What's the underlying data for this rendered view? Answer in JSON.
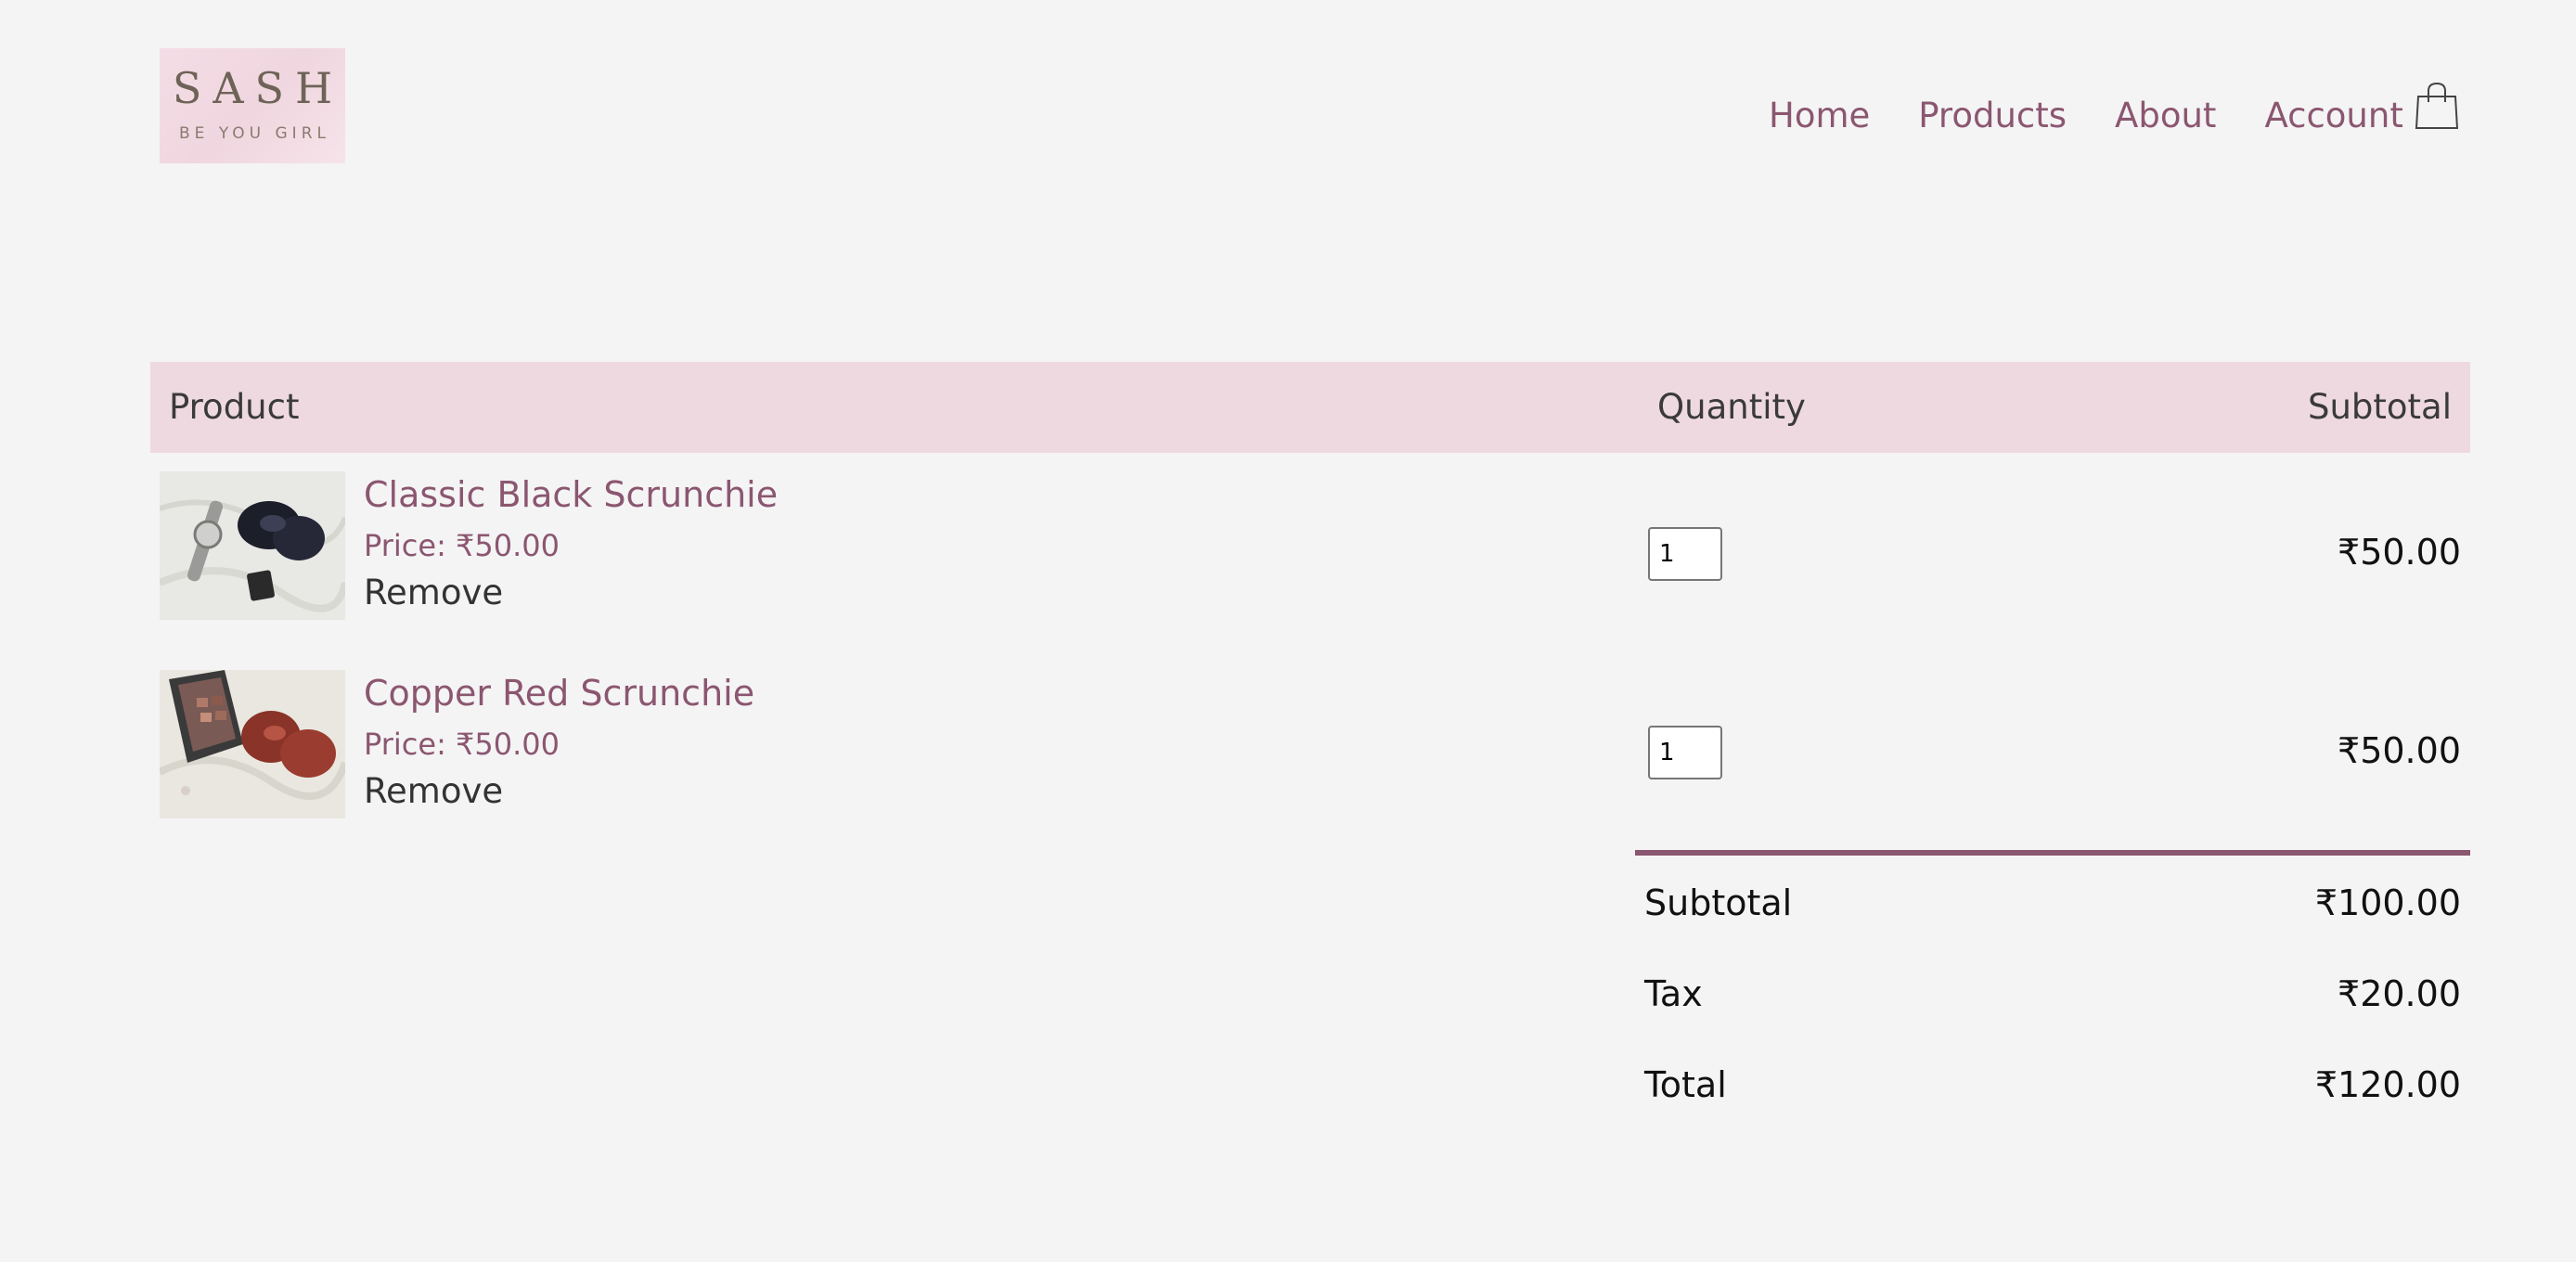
{
  "brand": {
    "logo_main": "SASH",
    "logo_tagline": "BE YOU GIRL"
  },
  "nav": {
    "items": [
      {
        "label": "Home"
      },
      {
        "label": "Products"
      },
      {
        "label": "About"
      },
      {
        "label": "Account"
      }
    ],
    "cart_icon": "shopping-bag-icon"
  },
  "cart": {
    "headers": {
      "product": "Product",
      "quantity": "Quantity",
      "subtotal": "Subtotal"
    },
    "items": [
      {
        "name": "Classic Black Scrunchie",
        "price": "Price: ₹50.00",
        "remove": "Remove",
        "quantity": "1",
        "subtotal": "₹50.00",
        "image": "black-scrunchie-photo"
      },
      {
        "name": "Copper Red Scrunchie",
        "price": "Price: ₹50.00",
        "remove": "Remove",
        "quantity": "1",
        "subtotal": "₹50.00",
        "image": "copper-red-scrunchie-photo"
      }
    ],
    "totals": {
      "subtotal_label": "Subtotal",
      "subtotal_value": "₹100.00",
      "tax_label": "Tax",
      "tax_value": "₹20.00",
      "total_label": "Total",
      "total_value": "₹120.00"
    }
  },
  "colors": {
    "accent": "#8b5670",
    "header_band": "#eed9e1",
    "background": "#f4f4f4"
  }
}
